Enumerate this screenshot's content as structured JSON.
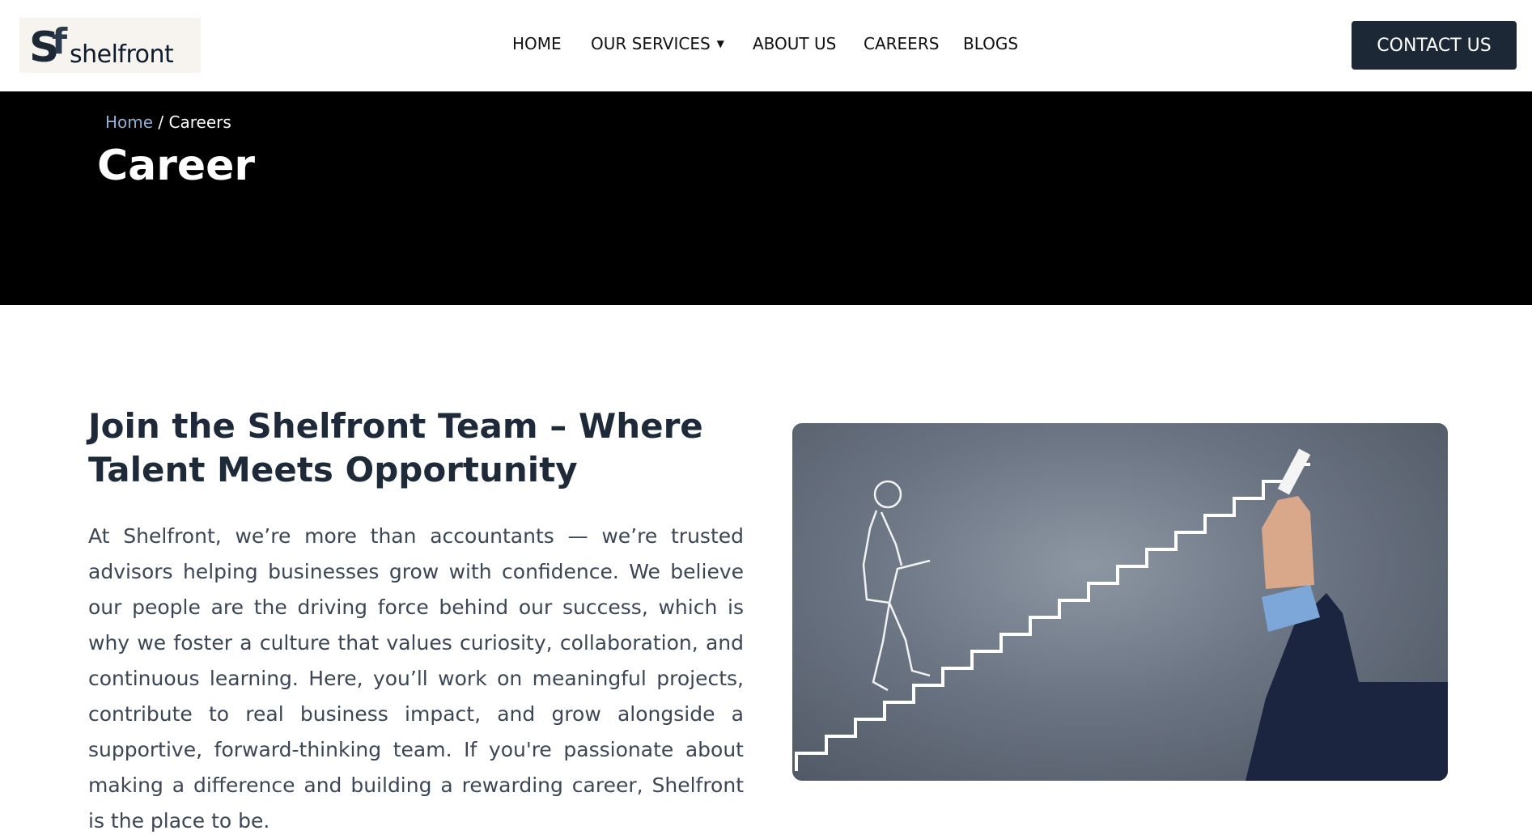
{
  "header": {
    "logo": {
      "mark": "Sf",
      "name": "shelfront"
    },
    "nav": [
      {
        "label": "HOME"
      },
      {
        "label": "OUR SERVICES",
        "has_dropdown": true
      },
      {
        "label": "ABOUT US"
      },
      {
        "label": "CAREERS"
      },
      {
        "label": "BLOGS"
      }
    ],
    "contact_label": "CONTACT US"
  },
  "banner": {
    "breadcrumb_home": "Home",
    "breadcrumb_sep": " / ",
    "breadcrumb_current": "Careers",
    "title": "Career"
  },
  "main": {
    "heading": "Join the Shelfront Team – Where Talent Meets Opportunity",
    "body": "At Shelfront, we’re more than accountants — we’re trusted advisors helping businesses grow with confidence. We believe our people are the driving force behind our success, which is why we foster a culture that values curiosity, collaboration, and continuous learning. Here, you’ll work on meaningful projects, contribute to real business impact, and grow alongside a supportive, forward-thinking team. If you're passionate about making a difference and building a rewarding career, Shelfront is the place to be."
  },
  "colors": {
    "brand_dark": "#1c2836",
    "banner_bg": "#000000",
    "link": "#8fb0d4"
  },
  "icons": {
    "dropdown": "caret-down-icon"
  }
}
